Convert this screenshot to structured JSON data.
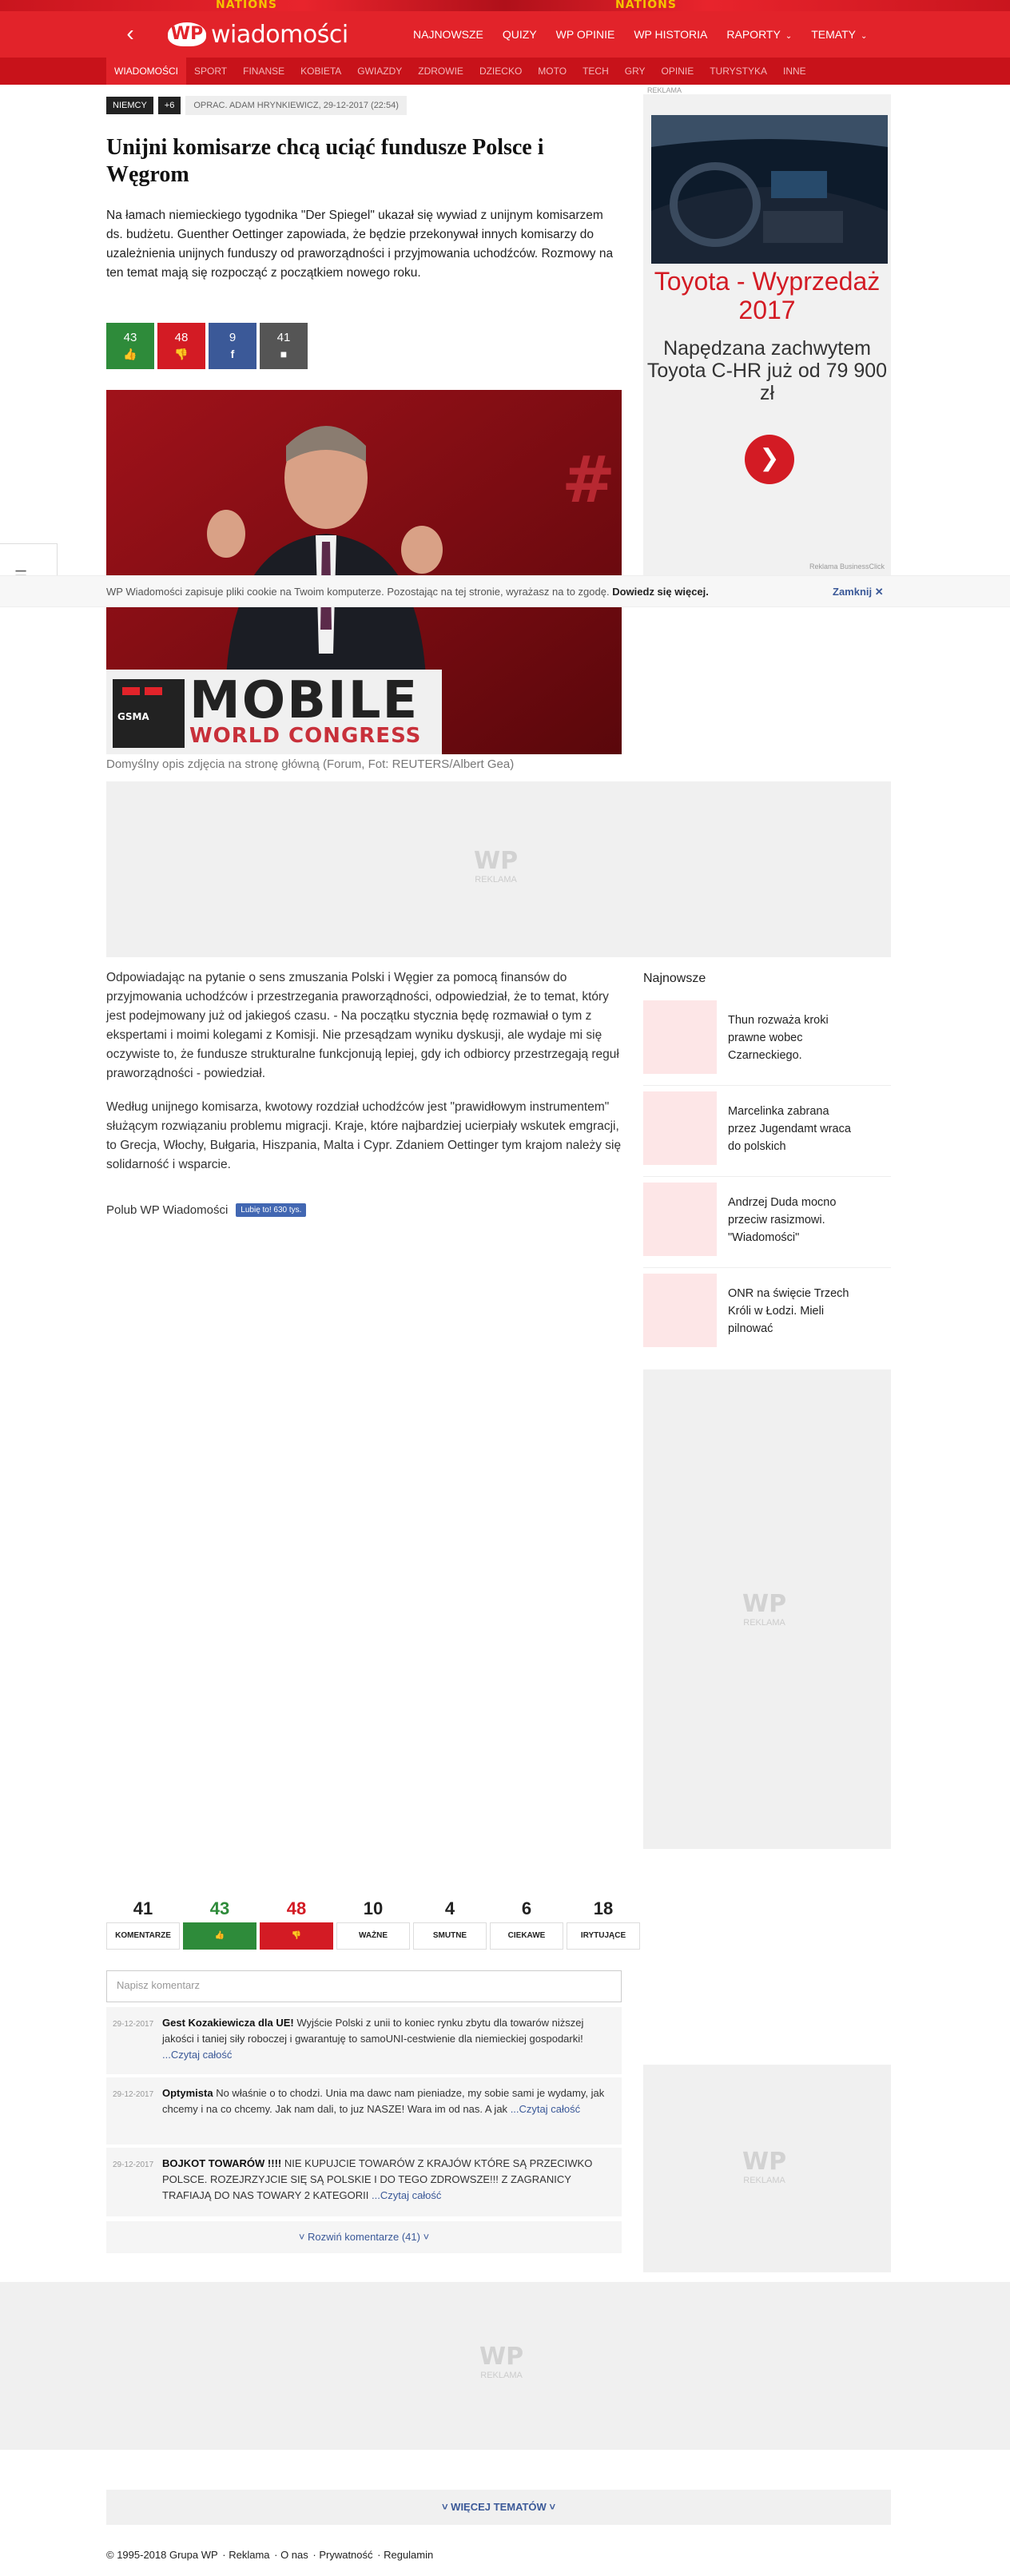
{
  "stripe": {
    "left_text": "NATIONS",
    "right_text": "NATIONS"
  },
  "header": {
    "logo_mark": "WP",
    "logo_text": "wiadomości",
    "nav": [
      "NAJNOWSZE",
      "QUIZY",
      "WP OPINIE",
      "WP HISTORIA",
      "RAPORTY",
      "TEMATY"
    ]
  },
  "subnav": [
    "WIADOMOŚCI",
    "SPORT",
    "FINANSE",
    "KOBIETA",
    "GWIAZDY",
    "ZDROWIE",
    "DZIECKO",
    "MOTO",
    "TECH",
    "GRY",
    "OPINIE",
    "TURYSTYKA",
    "INNE"
  ],
  "article": {
    "tag": "NIEMCY",
    "tag_more": "+6",
    "meta": "OPRAC. ADAM HRYNKIEWICZ, 29-12-2017 (22:54)",
    "title": "Unijni komisarze chcą uciąć fundusze Polsce i Węgrom",
    "lead": "Na łamach niemieckiego tygodnika \"Der Spiegel\" ukazał się wywiad z unijnym komisarzem ds. budżetu. Guenther Oettinger zapowiada, że będzie przekonywał innych komisarzy do uzależnienia unijnych funduszy od praworządności i przyjmowania uchodźców. Rozmowy na ten temat mają się rozpocząć z początkiem nowego roku.",
    "reactions": {
      "up": "43",
      "down": "48",
      "fb": "9",
      "comments": "41"
    },
    "image_text_top": "MOBILE",
    "image_text_bottom": "WORLD CONGRESS",
    "image_brand": "GSMA",
    "caption": "Domyślny opis zdjęcia na stronę główną (Forum, Fot: REUTERS/Albert Gea)",
    "paragraphs": [
      "Odpowiadając na pytanie o sens zmuszania Polski i Węgier za pomocą finansów do przyjmowania uchodźców i przestrzegania praworządności, odpowiedział, że to temat, który jest podejmowany już od jakiegoś czasu. - Na początku stycznia będę rozmawiał o tym z ekspertami i moimi kolegami z Komisji. Nie przesądzam wyniku dyskusji, ale wydaje mi się oczywiste to, że fundusze strukturalne funkcjonują lepiej, gdy ich odbiorcy przestrzegają reguł praworządności - powiedział.",
      "Według unijnego komisarza, kwotowy rozdział uchodźców jest \"prawidłowym instrumentem\" służącym rozwiązaniu problemu migracji. Kraje, które najbardziej ucierpiały wskutek emgracji, to Grecja, Włochy, Bułgaria, Hiszpania, Malta i Cypr. Zdaniem Oettinger tym krajom należy się solidarność i wsparcie."
    ],
    "like_label": "Polub WP Wiadomości",
    "fb_like": "Lubię to! 630 tys."
  },
  "ads": {
    "label": "REKLAMA",
    "placeholder_mark": "WP",
    "placeholder_label": "REKLAMA",
    "toyota_title": "Toyota - Wyprzedaż 2017",
    "toyota_sub": "Napędzana zachwytem Toyota C-HR już od 79 900 zł",
    "toyota_foot": "Reklama BusinessClick"
  },
  "cookie": {
    "text": "WP Wiadomości zapisuje pliki cookie na Twoim komputerze. Pozostając na tej stronie, wyrażasz na to zgodę.",
    "link": "Dowiedz się więcej.",
    "close": "Zamknij"
  },
  "sidebar": {
    "heading": "Najnowsze",
    "items": [
      "Thun rozważa kroki prawne wobec Czarneckiego.",
      "Marcelinka zabrana przez Jugendamt wraca do polskich",
      "Andrzej Duda mocno przeciw rasizmowi. \"Wiadomości\"",
      "ONR na święcie Trzech Króli w Łodzi. Mieli pilnować"
    ]
  },
  "comments": {
    "stats": [
      {
        "n": "41",
        "label": "KOMENTARZE"
      },
      {
        "n": "43",
        "label": ""
      },
      {
        "n": "48",
        "label": ""
      },
      {
        "n": "10",
        "label": "WAŻNE"
      },
      {
        "n": "4",
        "label": "SMUTNE"
      },
      {
        "n": "6",
        "label": "CIEKAWE"
      },
      {
        "n": "18",
        "label": "IRYTUJĄCE"
      }
    ],
    "placeholder": "Napisz komentarz",
    "items": [
      {
        "date": "29-12-2017",
        "author": "Gest Kozakiewicza dla UE!",
        "text": "Wyjście Polski z unii to koniec rynku zbytu dla towarów niższej jakości i taniej siły roboczej i gwarantuję to samoUNI-cestwienie dla niemieckiej gospodarki!",
        "more": "...Czytaj całość"
      },
      {
        "date": "29-12-2017",
        "author": "Optymista",
        "text": "No właśnie o to chodzi. Unia ma dawc nam pieniadze, my sobie sami je wydamy, jak chcemy i na co chcemy. Jak nam dali, to juz NASZE! Wara im od nas. A jak",
        "more": "...Czytaj całość"
      },
      {
        "date": "29-12-2017",
        "author": "BOJKOT TOWARÓW !!!!",
        "text": "NIE KUPUJCIE TOWARÓW Z KRAJÓW KTÓRE SĄ PRZECIWKO POLSCE. ROZEJRZYJCIE SIĘ SĄ POLSKIE I DO TEGO ZDROWSZE!!! Z ZAGRANICY TRAFIAJĄ DO NAS TOWARY 2 KATEGORII",
        "more": "...Czytaj całość"
      }
    ],
    "expand": "Rozwiń komentarze (41)"
  },
  "more_topics": "WIĘCEJ TEMATÓW",
  "footer": [
    "© 1995-2018 Grupa WP",
    "Reklama",
    "O nas",
    "Prywatność",
    "Regulamin"
  ]
}
